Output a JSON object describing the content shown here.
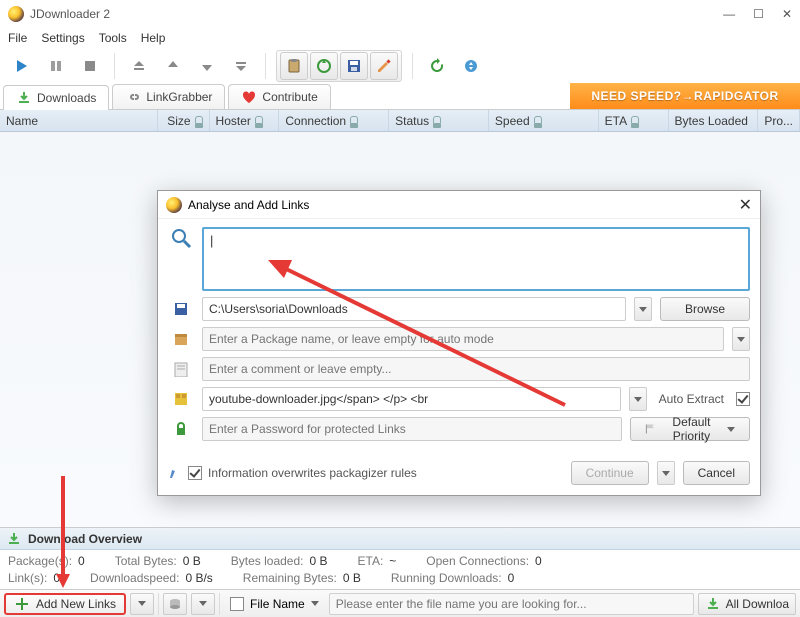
{
  "titlebar": {
    "title": "JDownloader 2"
  },
  "menu": {
    "file": "File",
    "settings": "Settings",
    "tools": "Tools",
    "help": "Help"
  },
  "tabs": {
    "downloads": "Downloads",
    "linkgrabber": "LinkGrabber",
    "contribute": "Contribute"
  },
  "promo": "NEED SPEED?→RAPIDGATOR",
  "columns": {
    "name": "Name",
    "size": "Size",
    "hoster": "Hoster",
    "connection": "Connection",
    "status": "Status",
    "speed": "Speed",
    "eta": "ETA",
    "bytes_loaded": "Bytes Loaded",
    "pro": "Pro..."
  },
  "dialog": {
    "title": "Analyse and Add Links",
    "url_value": "|",
    "path_value": "C:\\Users\\soria\\Downloads",
    "browse": "Browse",
    "package_placeholder": "Enter a Package name, or leave empty for auto mode",
    "comment_placeholder": "Enter a comment or leave empty...",
    "archive_value": "youtube-downloader.jpg</span> </p> <br",
    "auto_extract": "Auto Extract",
    "password_placeholder": "Enter a Password for protected Links",
    "priority": "Default Priority",
    "info_overwrite": "Information overwrites packagizer rules",
    "continue": "Continue",
    "cancel": "Cancel"
  },
  "overview": {
    "title": "Download Overview",
    "packages_lbl": "Package(s):",
    "packages_val": "0",
    "total_bytes_lbl": "Total Bytes:",
    "total_bytes_val": "0 B",
    "bytes_loaded_lbl": "Bytes loaded:",
    "bytes_loaded_val": "0 B",
    "eta_lbl": "ETA:",
    "eta_val": "~",
    "open_conn_lbl": "Open Connections:",
    "open_conn_val": "0",
    "links_lbl": "Link(s):",
    "links_val": "0",
    "dlspeed_lbl": "Downloadspeed:",
    "dlspeed_val": "0 B/s",
    "remaining_lbl": "Remaining Bytes:",
    "remaining_val": "0 B",
    "running_lbl": "Running Downloads:",
    "running_val": "0"
  },
  "bottombar": {
    "add_links": "Add New Links",
    "filename_lbl": "File Name",
    "search_placeholder": "Please enter the file name you are looking for...",
    "all_downloads": "All Downloa"
  }
}
